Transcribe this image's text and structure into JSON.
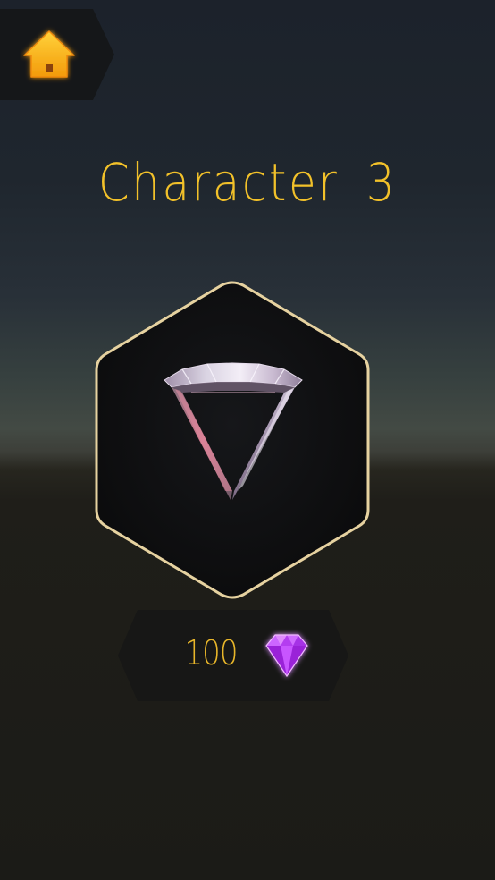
{
  "screen": {
    "title": "Character 3"
  },
  "home_button": {
    "icon": "home-icon",
    "color": "#f8b417"
  },
  "character_preview": {
    "icon": "character-crystal-ring"
  },
  "price": {
    "value": "100",
    "currency_icon": "purple-gem-icon",
    "currency_color": "#c74bff"
  },
  "colors": {
    "title": "#f2c12a",
    "frame_border": "#e6d2a0",
    "panel": "#111214"
  }
}
